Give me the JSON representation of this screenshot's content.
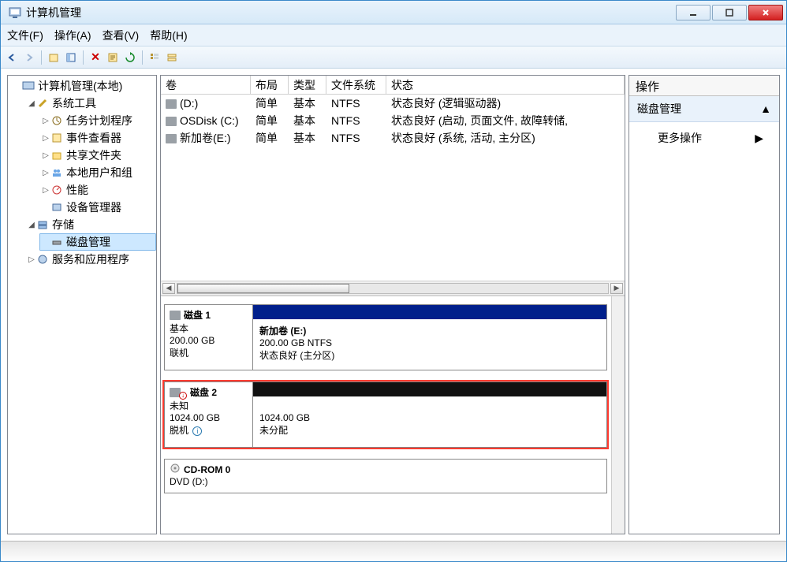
{
  "window": {
    "title": "计算机管理"
  },
  "menu": {
    "file": "文件(F)",
    "action": "操作(A)",
    "view": "查看(V)",
    "help": "帮助(H)"
  },
  "tree": {
    "root": "计算机管理(本地)",
    "sys_tools": "系统工具",
    "task_scheduler": "任务计划程序",
    "event_viewer": "事件查看器",
    "shared_folders": "共享文件夹",
    "local_users": "本地用户和组",
    "performance": "性能",
    "device_manager": "设备管理器",
    "storage": "存储",
    "disk_mgmt": "磁盘管理",
    "services_apps": "服务和应用程序"
  },
  "vol_header": {
    "volume": "卷",
    "layout": "布局",
    "type": "类型",
    "fs": "文件系统",
    "status": "状态"
  },
  "volumes": [
    {
      "name": "(D:)",
      "layout": "简单",
      "type": "基本",
      "fs": "NTFS",
      "status": "状态良好 (逻辑驱动器)"
    },
    {
      "name": "OSDisk (C:)",
      "layout": "简单",
      "type": "基本",
      "fs": "NTFS",
      "status": "状态良好 (启动, 页面文件, 故障转储,"
    },
    {
      "name": "新加卷(E:)",
      "layout": "简单",
      "type": "基本",
      "fs": "NTFS",
      "status": "状态良好 (系统, 活动, 主分区)"
    }
  ],
  "disks": {
    "d1": {
      "title": "磁盘 1",
      "line1": "基本",
      "line2": "200.00 GB",
      "line3": "联机",
      "vol_name": "新加卷  (E:)",
      "vol_line2": "200.00 GB NTFS",
      "vol_line3": "状态良好 (主分区)"
    },
    "d2": {
      "title": "磁盘 2",
      "line1": "未知",
      "line2": "1024.00 GB",
      "line3": "脱机",
      "vol_line2": "1024.00 GB",
      "vol_line3": "未分配"
    },
    "cd": {
      "title": "CD-ROM 0",
      "line1": "DVD (D:)"
    }
  },
  "actions": {
    "header": "操作",
    "section": "磁盘管理",
    "more": "更多操作"
  }
}
